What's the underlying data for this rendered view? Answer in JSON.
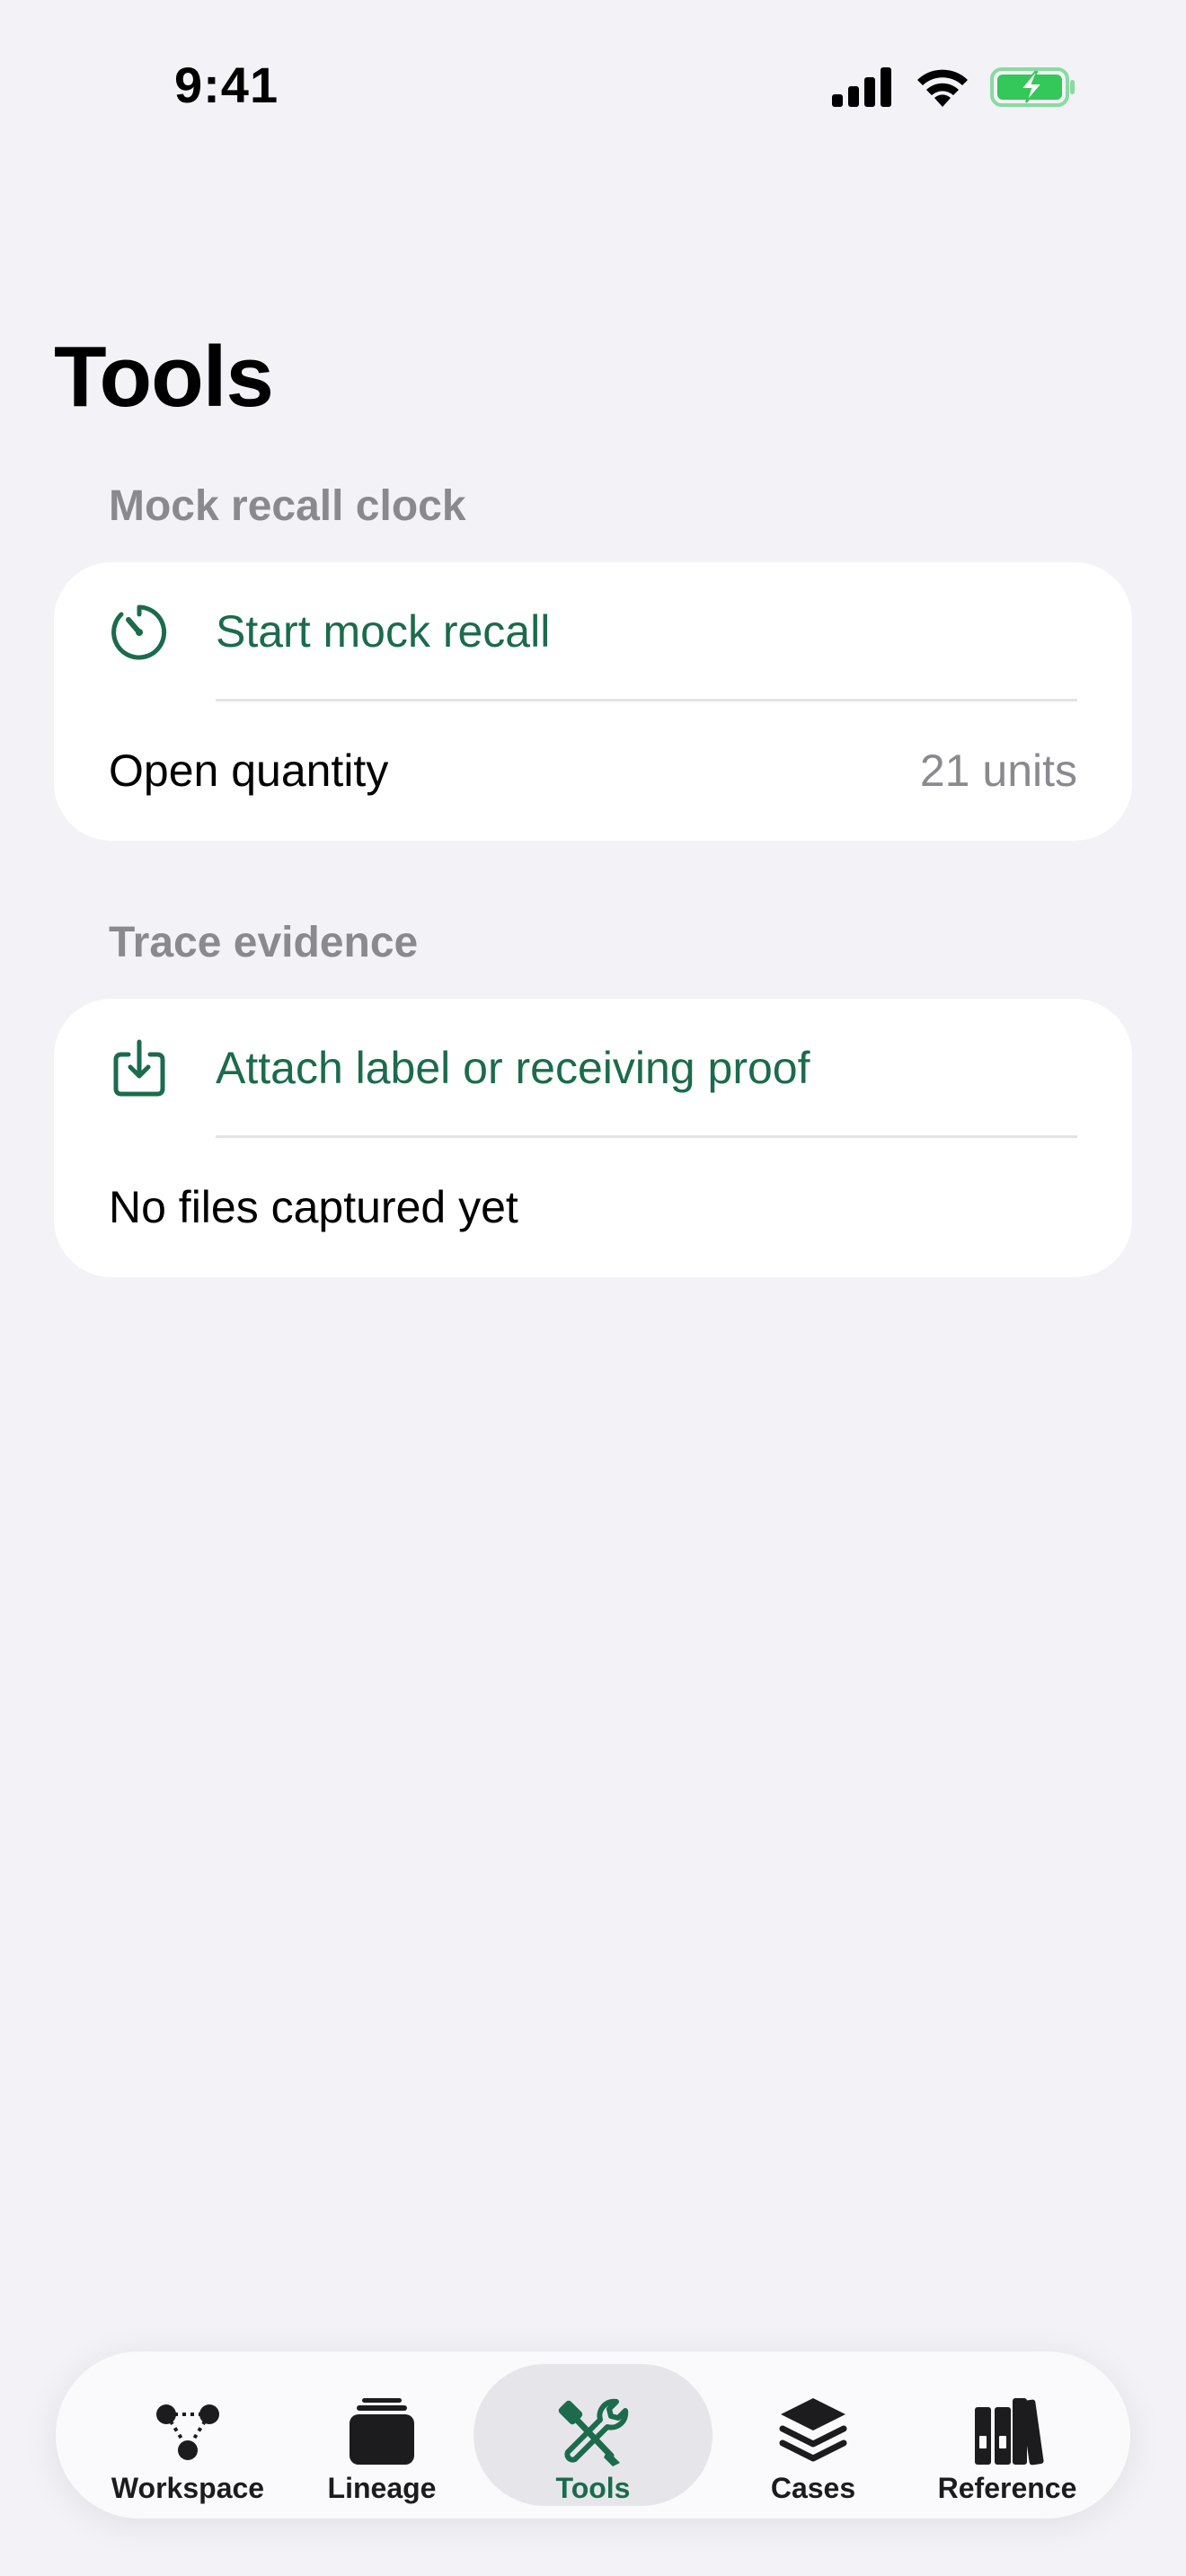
{
  "status_bar": {
    "time": "9:41",
    "icons": [
      "cellular-signal-icon",
      "wifi-icon",
      "battery-charging-icon"
    ]
  },
  "page": {
    "title": "Tools"
  },
  "sections": {
    "mock_recall": {
      "header": "Mock recall clock",
      "action_label": "Start mock recall",
      "action_icon": "timer-icon",
      "quantity_label": "Open quantity",
      "quantity_value": "21 units"
    },
    "trace_evidence": {
      "header": "Trace evidence",
      "action_label": "Attach label or receiving proof",
      "action_icon": "download-tray-icon",
      "status_text": "No files captured yet"
    }
  },
  "tab_bar": {
    "active": "Tools",
    "tabs": [
      {
        "label": "Workspace",
        "icon": "network-nodes-icon"
      },
      {
        "label": "Lineage",
        "icon": "stacked-cards-icon"
      },
      {
        "label": "Tools",
        "icon": "wrench-screwdriver-icon"
      },
      {
        "label": "Cases",
        "icon": "layers-icon"
      },
      {
        "label": "Reference",
        "icon": "books-icon"
      }
    ]
  },
  "colors": {
    "accent": "#1b6b4c",
    "background": "#f2f2f7",
    "secondary_text": "#8a8a8e",
    "battery_green": "#34c759"
  }
}
